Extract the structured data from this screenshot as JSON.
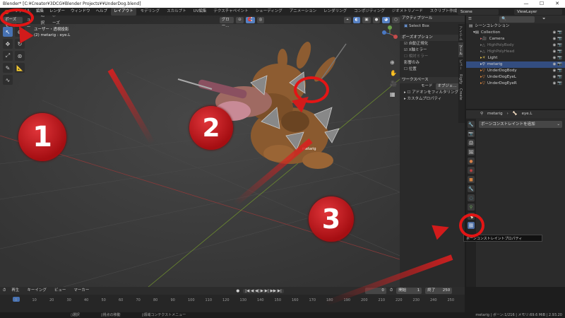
{
  "titlebar": {
    "title": "Blender* [C:¥Creator¥3DCG¥Blender Projects¥¥UnderDog.blend]"
  },
  "menu": [
    "ファイル",
    "編集",
    "レンダー",
    "ウィンドウ",
    "ヘルプ"
  ],
  "workspaces": [
    "レイアウト",
    "モデリング",
    "スカルプト",
    "UV編集",
    "テクスチャペイント",
    "シェーディング",
    "アニメーション",
    "レンダリング",
    "コンポジティング",
    "ジオメトリノード",
    "スクリプト作成"
  ],
  "scene": "Scene",
  "view_layer": "ViewLayer",
  "viewport": {
    "mode": "ポーズモード",
    "menus": [
      "ビュー",
      "選択",
      "ポーズ"
    ],
    "transform": "グロー...",
    "info_line1": "ユーザー・透視投影",
    "info_line2": "(2) metarig : eye.L",
    "armature_label": "metarig"
  },
  "npanel": {
    "tabs": [
      "アイテム",
      "ツール",
      "ビュー",
      "Rigify",
      "Create"
    ],
    "active_tool": "アクティブツール",
    "select_box": "Select Box",
    "pose_options": "ポーズオプション",
    "auto_normalize": "自動正規化",
    "x_mirror": "X軸ミラー",
    "relative_mirror": "相対ミラー",
    "affect_only": "影響のみ",
    "position": "位置",
    "workspace": "ワークスペース",
    "mode_label": "モード",
    "mode_value": "オブジェ...",
    "addon_filter": "アドオンをフィルタリング",
    "custom_props": "カスタムプロパティ"
  },
  "outliner": {
    "title": "シーンコレクション",
    "items": [
      "Collection",
      "Camera",
      "HighPolyBody",
      "HighPolyHead",
      "Light",
      "metarig",
      "UnderDogBody",
      "UnderDogEyeL",
      "UnderDogEyeR"
    ],
    "selected": "metarig"
  },
  "properties": {
    "breadcrumb_obj": "metarig",
    "breadcrumb_bone": "eye.L",
    "add_constraint": "ボーンコンストレイントを追加",
    "tooltip": "ボーンコンストレイントプロパティ"
  },
  "timeline": {
    "menus": [
      "再生",
      "キーイング",
      "ビュー",
      "マーカー"
    ],
    "current": "0",
    "start_label": "開始",
    "start": "1",
    "end_label": "終了",
    "end": "250",
    "ticks": [
      "0",
      "10",
      "20",
      "30",
      "40",
      "50",
      "60",
      "70",
      "80",
      "90",
      "100",
      "110",
      "120",
      "130",
      "140",
      "150",
      "160",
      "170",
      "180",
      "190",
      "200",
      "210",
      "220",
      "230",
      "240",
      "250"
    ]
  },
  "statusbar": {
    "left1": "選択",
    "left2": "視点の移動",
    "left3": "領域コンテクストメニュー",
    "right": "metarig | ボーン:1/216 | メモリ:69.6 MiB | 2.93.20"
  },
  "annotations": [
    "1",
    "2",
    "3"
  ],
  "colors": {
    "accent": "#4772b3",
    "annotation": "#d21b1b"
  }
}
